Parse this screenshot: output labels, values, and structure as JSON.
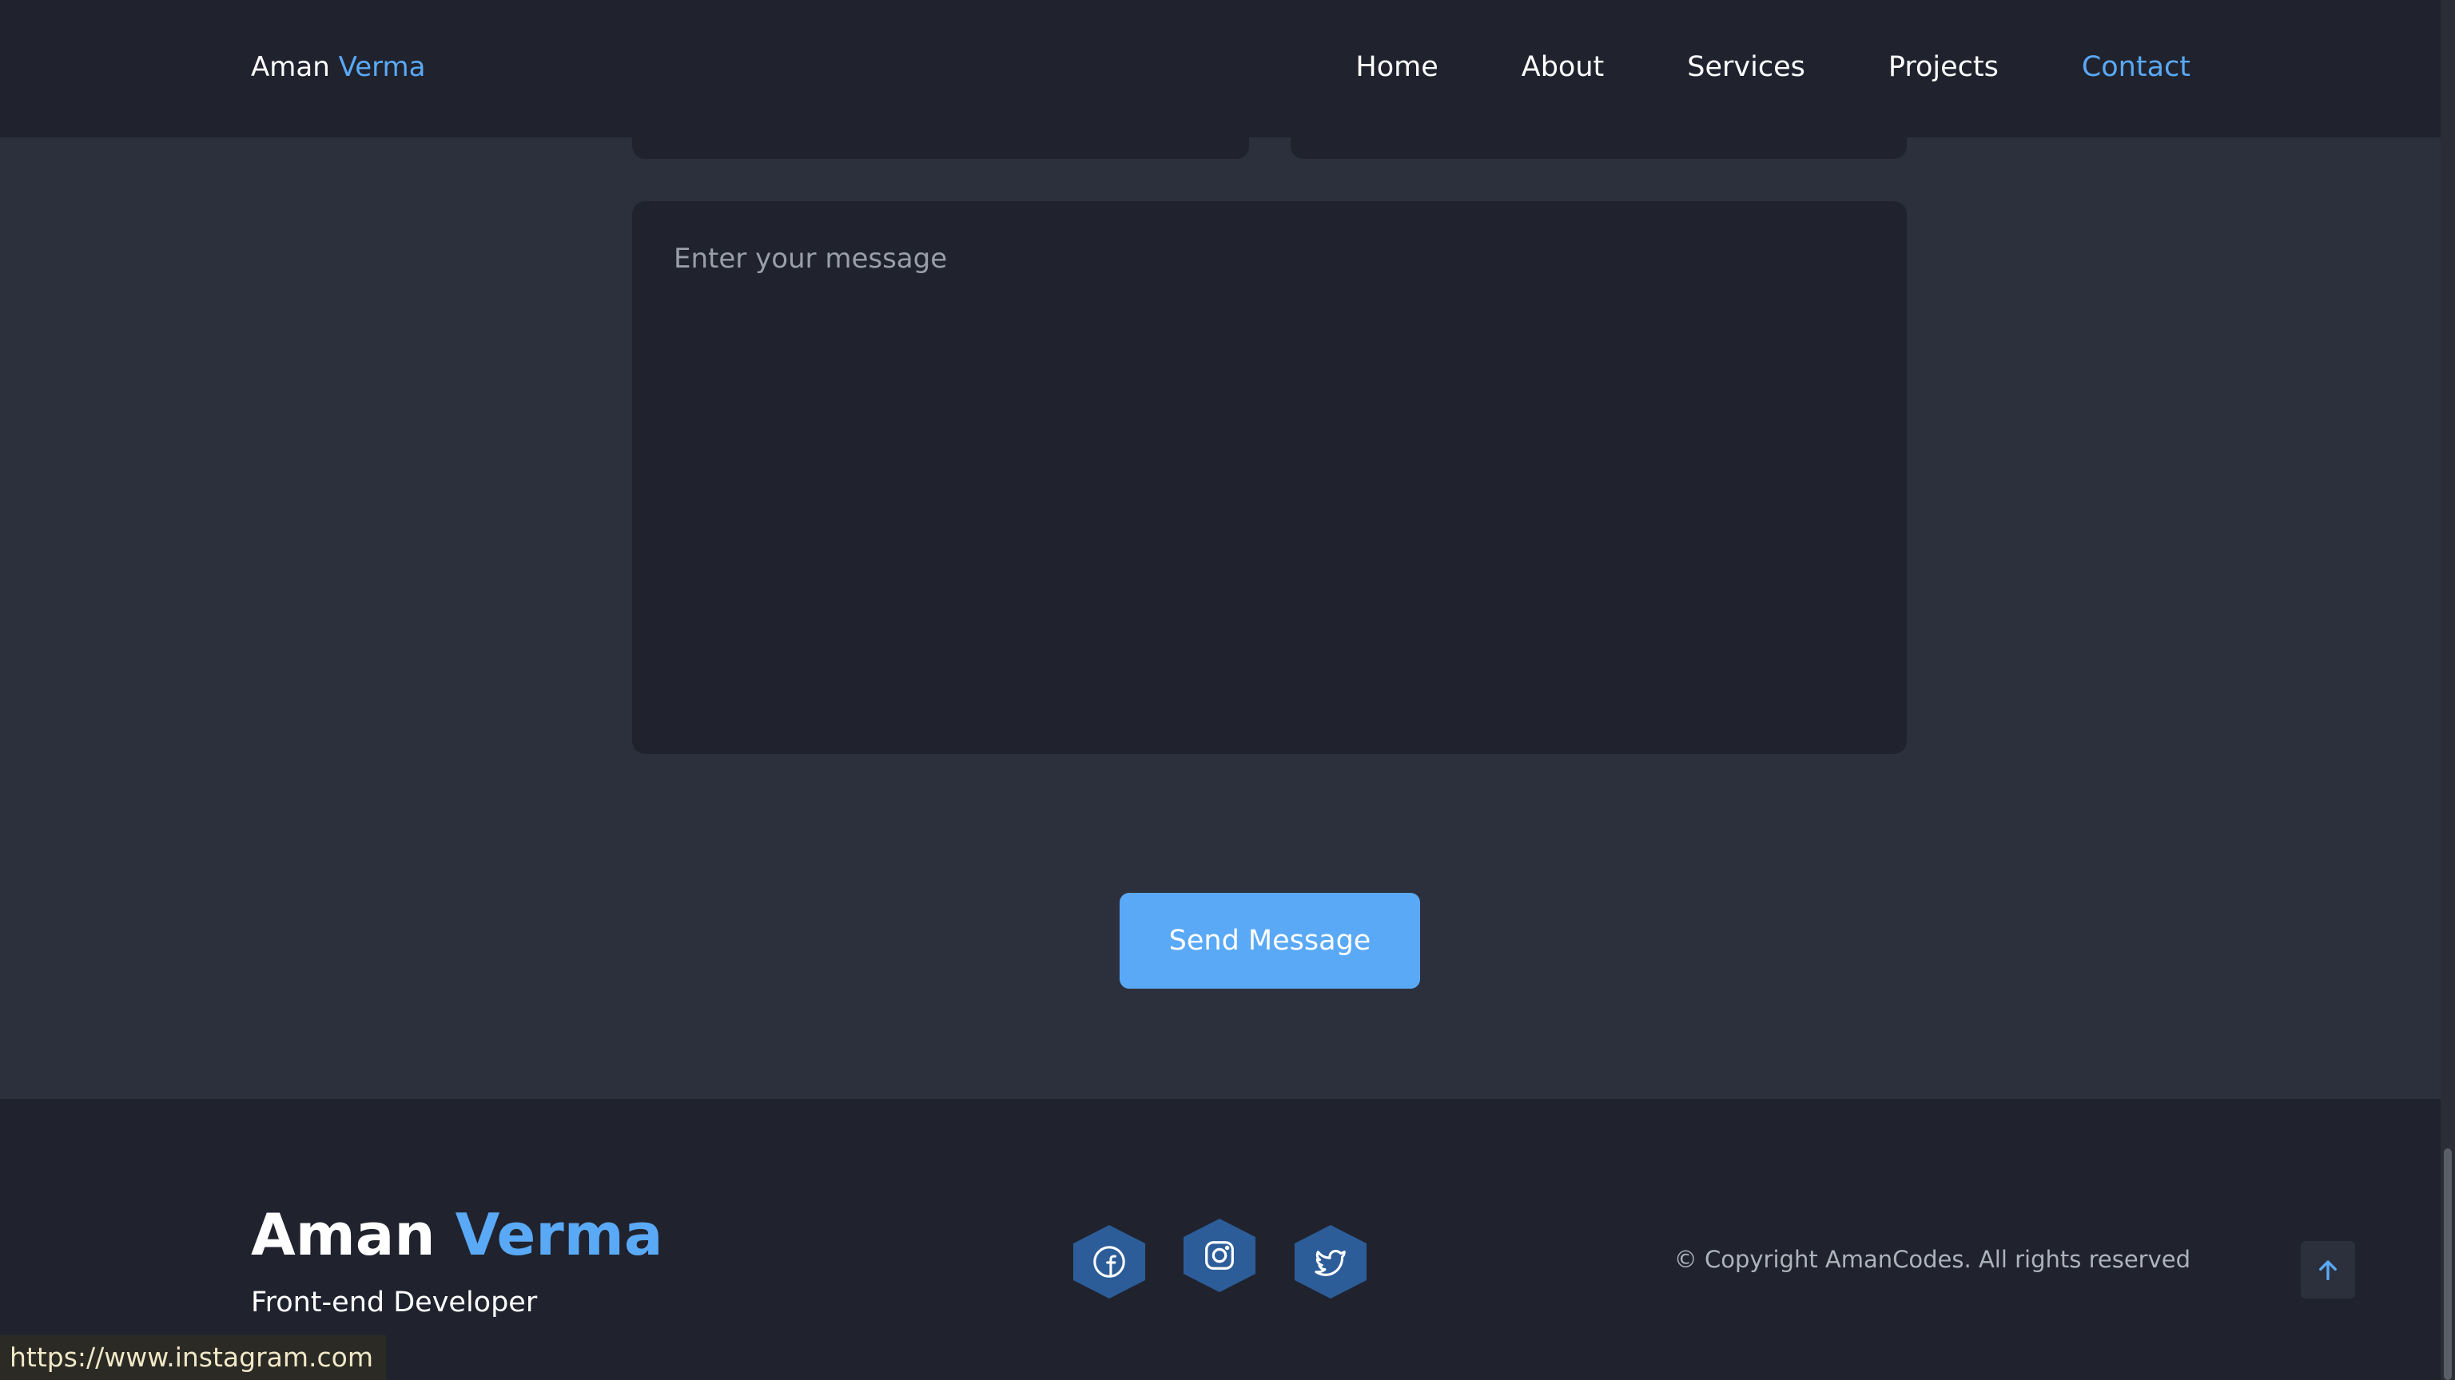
{
  "nav": {
    "brand_first": "Aman",
    "brand_second": "Verma",
    "links": [
      {
        "label": "Home",
        "active": false
      },
      {
        "label": "About",
        "active": false
      },
      {
        "label": "Services",
        "active": false
      },
      {
        "label": "Projects",
        "active": false
      },
      {
        "label": "Contact",
        "active": true
      }
    ]
  },
  "form": {
    "message_placeholder": "Enter your message",
    "submit_label": "Send Message"
  },
  "footer": {
    "brand_first": "Aman",
    "brand_second": "Verma",
    "role": "Front-end Developer",
    "social": [
      {
        "icon": "facebook-icon"
      },
      {
        "icon": "instagram-icon"
      },
      {
        "icon": "twitter-icon"
      }
    ],
    "copyright": "© Copyright AmanCodes. All rights reserved",
    "back_to_top_icon": "arrow-up-icon"
  },
  "status_bar": {
    "url": "https://www.instagram.com"
  },
  "colors": {
    "accent": "#5aa9f6",
    "background": "#2c303d",
    "surface": "#20232e",
    "social_bg": "#2c5d99"
  }
}
